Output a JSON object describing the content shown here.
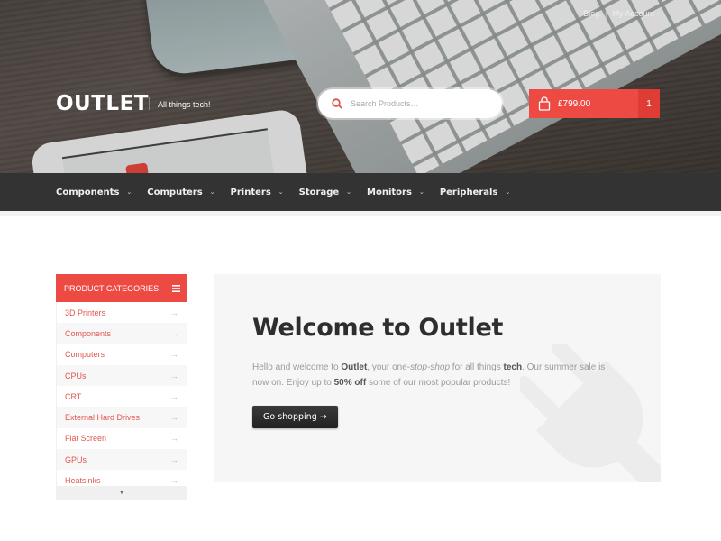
{
  "header": {
    "top_links": [
      {
        "label": "Blog"
      },
      {
        "label": "My Account"
      }
    ],
    "top_links_separator": "|",
    "logo": "OUTLET",
    "tagline": "All things tech!",
    "search": {
      "placeholder": "Search Products…",
      "value": ""
    },
    "cart": {
      "total": "£799.00",
      "count": "1"
    }
  },
  "nav": {
    "items": [
      {
        "label": "Components",
        "chevron": "⌄"
      },
      {
        "label": "Computers",
        "chevron": "⌄"
      },
      {
        "label": "Printers",
        "chevron": "⌄"
      },
      {
        "label": "Storage",
        "chevron": "⌄"
      },
      {
        "label": "Monitors",
        "chevron": "⌄"
      },
      {
        "label": "Peripherals",
        "chevron": "⌄"
      }
    ]
  },
  "sidebar": {
    "title": "PRODUCT CATEGORIES",
    "item_arrow": "→",
    "more_glyph": "▼",
    "items": [
      {
        "label": "3D Printers"
      },
      {
        "label": "Components"
      },
      {
        "label": "Computers"
      },
      {
        "label": "CPUs"
      },
      {
        "label": "CRT"
      },
      {
        "label": "External Hard Drives"
      },
      {
        "label": "Flat Screen"
      },
      {
        "label": "GPUs"
      },
      {
        "label": "Heatsinks"
      }
    ]
  },
  "welcome": {
    "title": "Welcome to Outlet",
    "body": {
      "p1": "Hello and welcome to ",
      "b1": "Outlet",
      "p2": ", your one-",
      "i1": "stop-shop",
      "p3": " for all things ",
      "b2": "tech",
      "p4": ". Our summer sale is now on. Enjoy up to ",
      "b3": "50% off",
      "p5": " some of our most popular products!"
    },
    "button_label": "Go shopping →"
  },
  "colors": {
    "accent": "#ee4a44",
    "nav_bg": "#333333",
    "panel_bg": "#f6f6f6"
  }
}
